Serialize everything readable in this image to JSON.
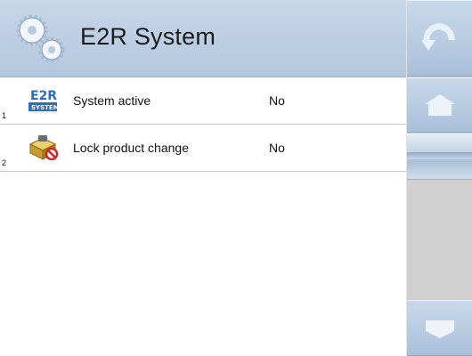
{
  "header": {
    "title": "E2R System",
    "icon": "gears-icon"
  },
  "rows": [
    {
      "number": "1",
      "label": "System active",
      "value": "No",
      "icon": "e2r-system-icon"
    },
    {
      "number": "2",
      "label": "Lock product change",
      "value": "No",
      "icon": "locked-box-icon"
    }
  ],
  "sidebar": {
    "back_icon": "undo-arrow-icon",
    "home_icon": "home-icon",
    "scroll_icon": "scroll-thumb",
    "down_icon": "scroll-down-icon"
  },
  "colors": {
    "header_bg": "#c7d6e8",
    "button_bg": "#b8cbe0",
    "sidebar_bg": "#cfcfcf",
    "icon_blue": "#2a6db8",
    "icon_yellow": "#e8d23a"
  }
}
